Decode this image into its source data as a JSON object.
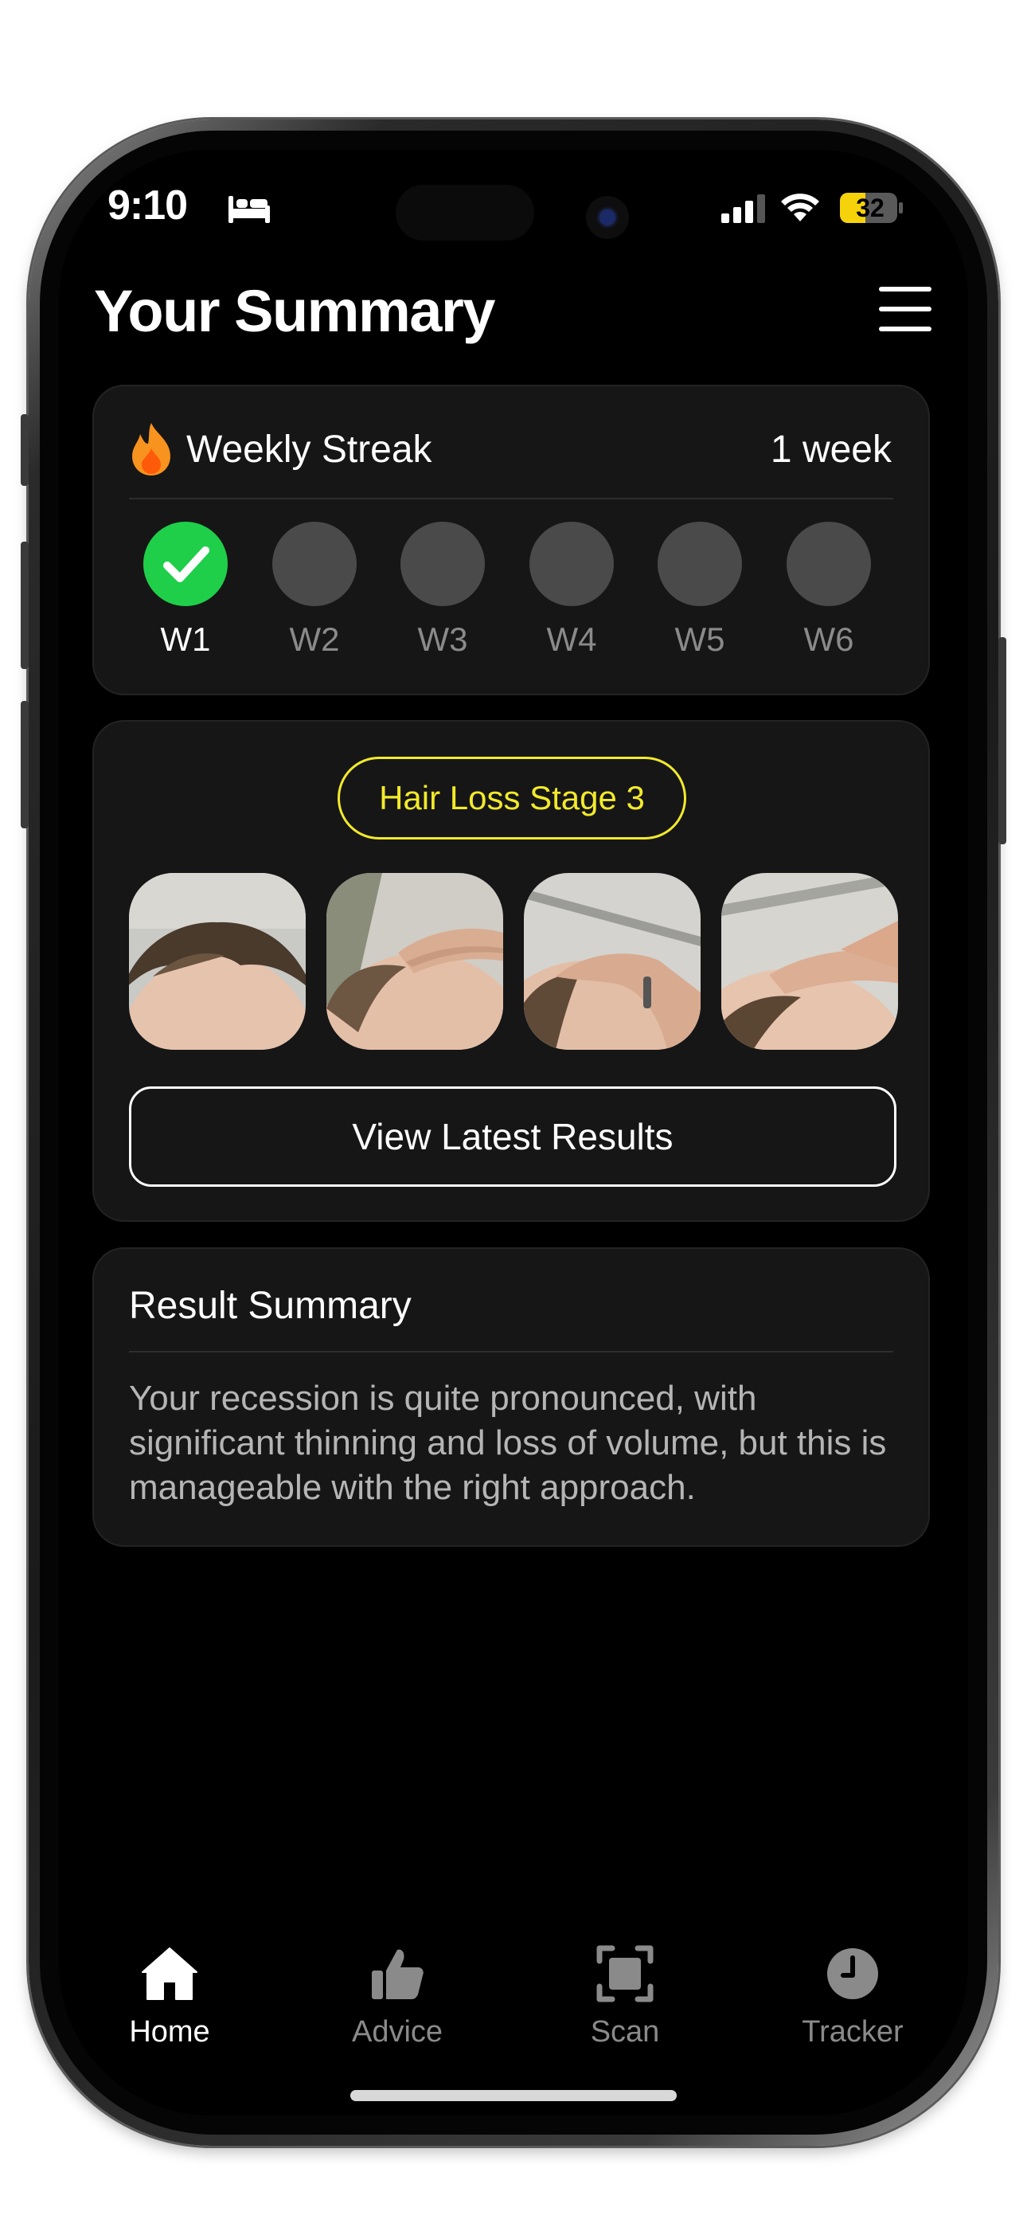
{
  "status_bar": {
    "time": "9:10",
    "battery": "32",
    "focus_icon": "bed-icon"
  },
  "header": {
    "title": "Your Summary",
    "menu_icon": "hamburger-menu-icon"
  },
  "streak": {
    "title": "Weekly Streak",
    "count": "1 week",
    "icon": "flame-icon",
    "weeks": [
      {
        "label": "W1",
        "done": true
      },
      {
        "label": "W2",
        "done": false
      },
      {
        "label": "W3",
        "done": false
      },
      {
        "label": "W4",
        "done": false
      },
      {
        "label": "W5",
        "done": false
      },
      {
        "label": "W6",
        "done": false
      }
    ]
  },
  "hair": {
    "stage_label": "Hair Loss Stage 3",
    "photos": [
      "front-view",
      "left-side-view",
      "right-side-view",
      "top-view"
    ],
    "view_button": "View Latest Results"
  },
  "result_summary": {
    "title": "Result Summary",
    "body": "Your recession is quite pronounced, with significant thinning and loss of volume, but this is manageable with the right approach."
  },
  "tabs": [
    {
      "label": "Home",
      "icon": "home-icon",
      "active": true
    },
    {
      "label": "Advice",
      "icon": "thumbs-up-icon",
      "active": false
    },
    {
      "label": "Scan",
      "icon": "scan-icon",
      "active": false
    },
    {
      "label": "Tracker",
      "icon": "clock-icon",
      "active": false
    }
  ],
  "colors": {
    "accent_yellow": "#f2ea2a",
    "streak_green": "#1fcf4a",
    "flame_orange": "#f7931e",
    "card_bg": "#161616",
    "inactive": "#8a8a8a"
  }
}
